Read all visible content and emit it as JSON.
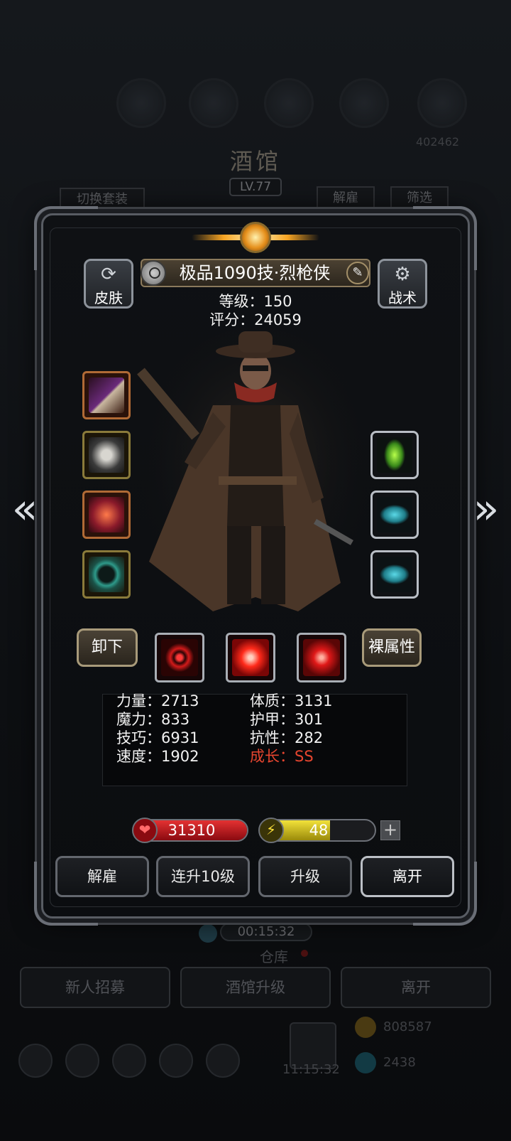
{
  "background": {
    "title": "酒馆",
    "level": "LV.77",
    "counter": "402462",
    "switch_outfit": "切换套装",
    "dismiss": "解雇",
    "filter": "筛选",
    "timer": "00:15:32",
    "warehouse": "仓库",
    "recruit": "新人招募",
    "tavern_upgrade": "酒馆升级",
    "leave": "离开",
    "gift_timer": "11:15:32",
    "gold": "808587",
    "gems": "2438"
  },
  "hero": {
    "name": "极品1090技·烈枪侠",
    "level_label": "等级：",
    "level": "150",
    "score_label": "评分：",
    "score": "24059"
  },
  "buttons": {
    "skin": "皮肤",
    "tactics": "战术",
    "unequip": "卸下",
    "base_attr": "裸属性",
    "fire": "解雇",
    "level_up_10": "连升10级",
    "level_up": "升级",
    "leave": "离开"
  },
  "stats": {
    "strength": "力量：2713",
    "constitution": "体质：3131",
    "magic": "魔力：833",
    "armor": "护甲：301",
    "skill": "技巧：6931",
    "resistance": "抗性：282",
    "speed": "速度：1902",
    "growth": "成长：SS"
  },
  "bars": {
    "hp": "31310",
    "energy": "48",
    "energy_fraction": 0.6
  },
  "icons": {
    "arrow_left": "«",
    "arrow_right": "»",
    "edit": "✎",
    "plus": "+",
    "heart": "❤",
    "bolt": "⚡",
    "skin_glyph": "⟳",
    "gear": "⚙"
  },
  "colors": {
    "growth": "#e5452f",
    "hp": "#c8141c",
    "energy": "#d8c21a"
  }
}
